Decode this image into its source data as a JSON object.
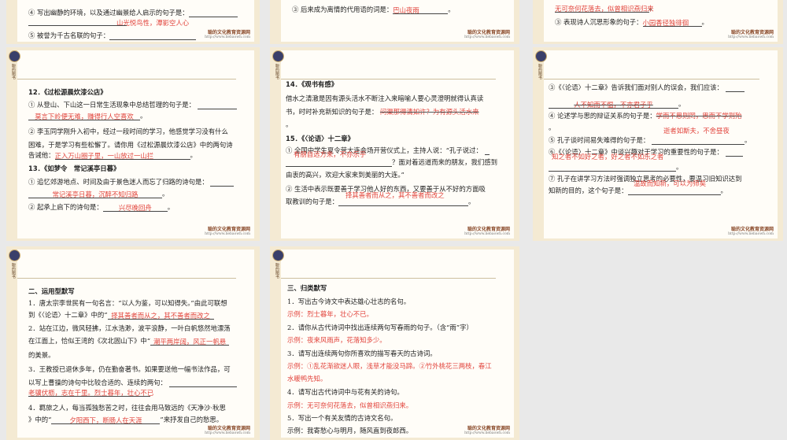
{
  "brand": {
    "logo_text": "聪的图书",
    "watermark": "聪的文化教育资源网",
    "url": "http://www.liebaowh.com"
  },
  "colors": {
    "answer": "#e2443c",
    "frame": "#f4ead3",
    "background": "#e9e9e9"
  },
  "top1": {
    "q4": "④ 写出幽静的环境，以及通过幽景给人启示的句子是：",
    "a4": "山光悦鸟性，潭影空人心",
    "q5": "⑤ 被誉为千古名联的句子："
  },
  "top2": {
    "q3": "③ 后来成为离情的代用语的词是：",
    "a3": "巴山夜雨",
    "end": "。"
  },
  "top3": {
    "a2": "无可奈何花落去，似曾相识燕归来",
    "q3": "③ 表现诗人沉思形象的句子：",
    "a3": "小园香径独徘徊",
    "end": "。"
  },
  "s1": {
    "t12": "12．《过松源晨炊漆公店》",
    "q1": "① 从登山、下山这一日常生活现象中总结哲理的句子是：",
    "a1": "莫言下岭便无难，赚得行人空喜欢",
    "q2a": "② 李玉同学刚升入初中，经过一段时间的学习，他感觉学习没有什么",
    "q2b": "困难，于是学习有些松懈了。请你用《过松源晨炊漆公店》中的两句诗",
    "q2c": "告诫他：",
    "a2": "正入万山圈子里，一山放过一山拦",
    "t13": "13．《如梦令　常记溪亭日暮》",
    "q3": "① 追忆郊游地点、时间及由于景色迷人而忘了归路的诗句是：",
    "a3": "常记溪亭日暮，沉醉不知归路",
    "q4": "② 起承上启下的诗句是：",
    "a4": "兴尽晚回舟",
    "end": "。"
  },
  "s2": {
    "t14": "14．《观书有感》",
    "q1a": "借水之清澈是因有源头活水不断注入来暗喻人要心灵澄明就得认真读",
    "q1b": "书，时时补充新知识的句子是：",
    "a1": "问渠那得清如许？为有源头活水来",
    "t15": "15．《〈论语〉十二章》",
    "q2a": "① 全国中学生夏令营大连会场开营仪式上，主持人说：“孔子说过：",
    "a2": "有朋自远方来，不亦乐乎",
    "q2b": "？面对着远道而来的朋友，我们感到",
    "q2c": "由衷的高兴，欢迎大家来到美丽的大连。”",
    "q3a": "② 生活中表示既要善于学习他人好的东西，又要善于从不好的方面吸",
    "a3": "择其善者而从之，其不善者而改之",
    "q3b": "取教训的句子是：",
    "end": "。"
  },
  "s3": {
    "q3": "③《〈论语〉十二章》告诉我们面对别人的误会，我们应该：",
    "a3": "人不知而不愠，不亦君子乎",
    "q4": "④ 论述学与思的辩证关系的句子是：",
    "a4": "学而不思则罔，思而不学则殆",
    "a5": "逝者如斯夫，不舍昼夜",
    "q5": "⑤ 孔子谈时间易失难得的句子是：",
    "q6": "⑥《〈论语〉十二章》中谈兴趣对于学习的重要性的句子是：",
    "a6": "知之者不如好之者，好之者不如乐之者",
    "q7a": "⑦ 孔子在讲学习方法时强调独立思考的必要性，要温习旧知识达到",
    "a7": "温故而知新，可以为师矣",
    "q7b": "知新的目的，这个句子是：",
    "end": "。"
  },
  "s4": {
    "title": "二、运用型默写",
    "q1a": "1．唐太宗李世民有一句名言：“以人为鉴，可以知得失。”由此可联想",
    "q1b": "到《〈论语〉十二章》中的“",
    "a1": "择其善者而从之，其不善者而改之",
    "q2a": "2．站在江边，微风轻拂，江水浩渺，波平浪静，一叶白帆悠然地漂荡",
    "q2b": "在江面上，恰似王湾的《次北固山下》中“",
    "a2": "潮平两岸阔，风正一帆悬",
    "q2c": "的美景。",
    "q3a": "3．王教授已退休多年，仍在勤奋著书。如果要送他一幅书法作品，可",
    "q3b": "以写上曹操的诗句中比较合适的、连续的两句：",
    "a3": "老骥伏枥，志在千里。烈士暮年，壮心不已",
    "q4a": "4．羁旅之人，每当孤独愁苦之时，往往会用马致远的《天净沙·秋思",
    "q4b": "》中的“",
    "a4": "夕阳西下，断肠人在天涯",
    "q4c": "”来抒发自己的愁思。"
  },
  "s5": {
    "title": "三、归类默写",
    "q1": "1．写出古今诗文中表达雄心壮志的名句。",
    "a1": "示例：烈士暮年，壮心不已。",
    "q2": "2．请你从古代诗词中找出连续两句写春雨的句子。（含“雨”字）",
    "a2": "示例：夜来风雨声，花落知多少。",
    "q3": "3．请写出连续两句你所喜欢的描写春天的古诗词。",
    "a3a": "示例：①乱花渐欲迷人眼，浅草才能没马蹄。②竹外桃花三两枝，春江",
    "a3b": "水暖鸭先知。",
    "q4": "4．请写出古代诗词中与花有关的诗句。",
    "a4": "示例：无可奈何花落去，似曾相识燕归来。",
    "q5": "5．写出一个有关友情的古诗文名句。",
    "a5": "示例：我寄愁心与明月，随风直到夜郎西。"
  }
}
